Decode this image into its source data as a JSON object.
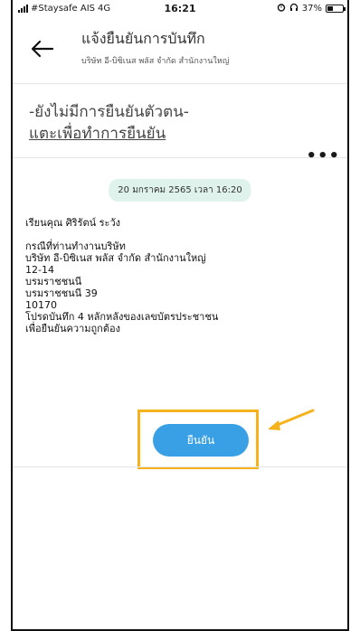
{
  "status_bar": {
    "carrier": "#Staysafe AIS",
    "network": "4G",
    "time": "16:21",
    "battery_percent": "37%",
    "battery_level": 0.37
  },
  "header": {
    "title": "แจ้งยืนยันการบันทึก",
    "subtitle": "บริษัท อี-บิซิเนส พลัส  จำกัด สำนักงานใหญ่"
  },
  "verification": {
    "status_text": "-ยังไม่มีการยืนยันตัวตน-",
    "link_text": "แตะเพื่อทำการยืนยัน"
  },
  "more_menu": "•••",
  "date_badge": "20 มกราคม 2565 เวลา 16:20",
  "message": {
    "greeting": "เรียนคุณ ศิริรัตน์ ระวัง",
    "lines": [
      "กรณีที่ท่านทำงานบริษัท",
      "บริษัท อี-บิซิเนส พลัส  จำกัด สำนักงานใหญ่",
      "12-14",
      "บรมราชชนนี",
      "บรมราชชนนี 39",
      "10170",
      "โปรดบันทึก 4 หลักหลังของเลขบัตรประชาชน",
      "เพื่อยืนยันความถูกต้อง"
    ]
  },
  "confirm_button": "ยืนยัน",
  "colors": {
    "confirm_button": "#3aa0e6",
    "highlight_box": "#f5b21c",
    "date_badge_bg": "#dff3ec"
  }
}
